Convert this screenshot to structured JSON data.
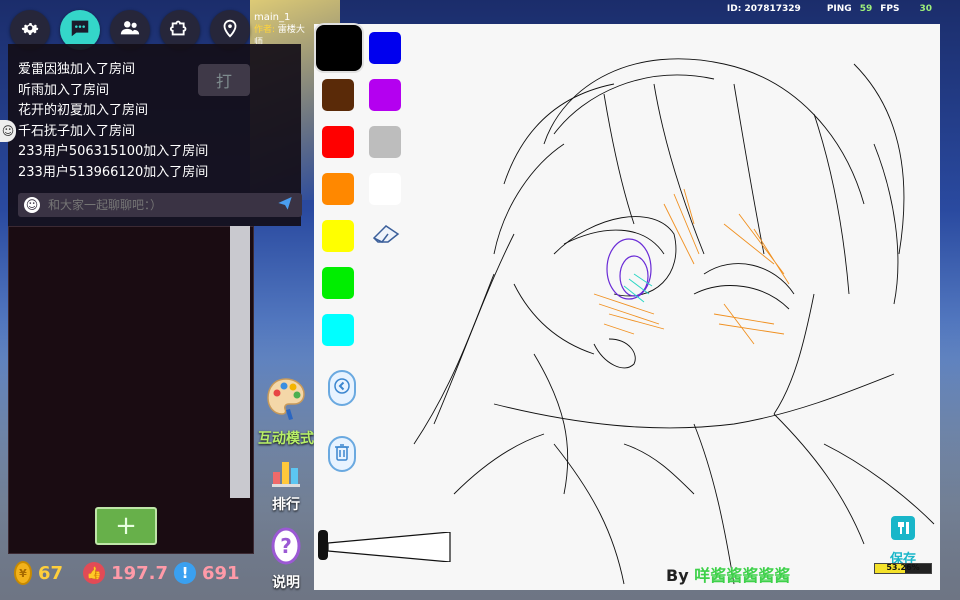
{
  "status": {
    "id_label": "ID: 207817329",
    "ping_label": "PING",
    "ping_value": "59",
    "fps_label": "FPS",
    "fps_value": "30"
  },
  "map": {
    "name": "main_1",
    "author_label": "作者:",
    "author_name": "雷楼大师"
  },
  "topbar": {
    "icons": [
      "gear-icon",
      "chat-icon",
      "people-icon",
      "puzzle-icon",
      "map-pin-icon"
    ]
  },
  "chat": {
    "lines": [
      "爱雷因独加入了房间",
      "听雨加入了房间",
      "花开的初夏加入了房间",
      "千石抚子加入了房间",
      "233用户506315100加入了房间",
      "233用户513966120加入了房间"
    ],
    "input_placeholder": "和大家一起聊聊吧：）",
    "hidden_tab_label": "打"
  },
  "lower_panel": {
    "add_label": "+"
  },
  "stats": {
    "coins": "67",
    "likes": "197.7",
    "views": "691"
  },
  "vmenu": {
    "interactive_mode": "互动模式",
    "ranking": "排行",
    "help": "说明"
  },
  "palette": {
    "colors": [
      "#000000",
      "#0000ee",
      "#5a2a08",
      "#b400f0",
      "#ff0000",
      "#bdbdbd",
      "#ff8800",
      "#ffffff",
      "#ffff00",
      "#00ee00",
      "#00ffff"
    ],
    "selected": "#000000"
  },
  "canvas": {
    "signature_prefix": "By",
    "signature_name": "咩酱酱酱酱酱",
    "save_label": "保存",
    "progress_label": "53.26%",
    "progress_value": 0.5326
  }
}
